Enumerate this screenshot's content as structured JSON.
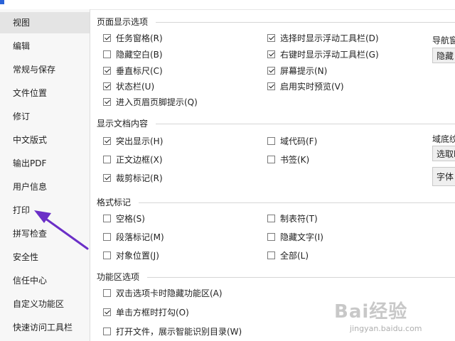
{
  "sidebar": {
    "items": [
      {
        "label": "视图",
        "active": true
      },
      {
        "label": "编辑"
      },
      {
        "label": "常规与保存"
      },
      {
        "label": "文件位置"
      },
      {
        "label": "修订"
      },
      {
        "label": "中文版式"
      },
      {
        "label": "输出PDF"
      },
      {
        "label": "用户信息"
      },
      {
        "label": "打印"
      },
      {
        "label": "拼写检查"
      },
      {
        "label": "安全性"
      },
      {
        "label": "信任中心"
      },
      {
        "label": "自定义功能区"
      },
      {
        "label": "快速访问工具栏"
      }
    ]
  },
  "sections": {
    "page_display": {
      "title": "页面显示选项",
      "options": [
        {
          "label": "任务窗格(R)",
          "checked": true
        },
        {
          "label": "隐藏空白(B)",
          "checked": false
        },
        {
          "label": "垂直标尺(C)",
          "checked": true
        },
        {
          "label": "状态栏(U)",
          "checked": true
        },
        {
          "label": "进入页眉页脚提示(Q)",
          "checked": true
        },
        {
          "label": "选择时显示浮动工具栏(D)",
          "checked": true
        },
        {
          "label": "右键时显示浮动工具栏(G)",
          "checked": true
        },
        {
          "label": "屏幕提示(N)",
          "checked": true
        },
        {
          "label": "启用实时预览(V)",
          "checked": true
        }
      ]
    },
    "doc_content": {
      "title": "显示文档内容",
      "options": [
        {
          "label": "突出显示(H)",
          "checked": true
        },
        {
          "label": "正文边框(X)",
          "checked": false
        },
        {
          "label": "裁剪标记(R)",
          "checked": true
        },
        {
          "label": "域代码(F)",
          "checked": false
        },
        {
          "label": "书签(K)",
          "checked": false
        }
      ]
    },
    "format_marks": {
      "title": "格式标记",
      "options": [
        {
          "label": "空格(S)",
          "checked": false
        },
        {
          "label": "段落标记(M)",
          "checked": false
        },
        {
          "label": "对象位置(J)",
          "checked": false
        },
        {
          "label": "制表符(T)",
          "checked": false
        },
        {
          "label": "隐藏文字(I)",
          "checked": false
        },
        {
          "label": "全部(L)",
          "checked": false
        }
      ]
    },
    "ribbon": {
      "title": "功能区选项",
      "options": [
        {
          "label": "双击选项卡时隐藏功能区(A)",
          "checked": false
        },
        {
          "label": "单击方框时打勾(O)",
          "checked": true
        },
        {
          "label": "打开文件，展示智能识别目录(W)",
          "checked": false
        }
      ]
    }
  },
  "right_panel": {
    "nav_label": "导航窗",
    "nav_button": "隐藏",
    "field_label": "域底纹",
    "field_button": "选取时",
    "font_button": "字体"
  },
  "watermark": {
    "logo": "Bai经验",
    "url": "jingyan.baidu.com"
  },
  "colors": {
    "arrow": "#6b2fc7",
    "active_item": "#e4e4e4"
  }
}
